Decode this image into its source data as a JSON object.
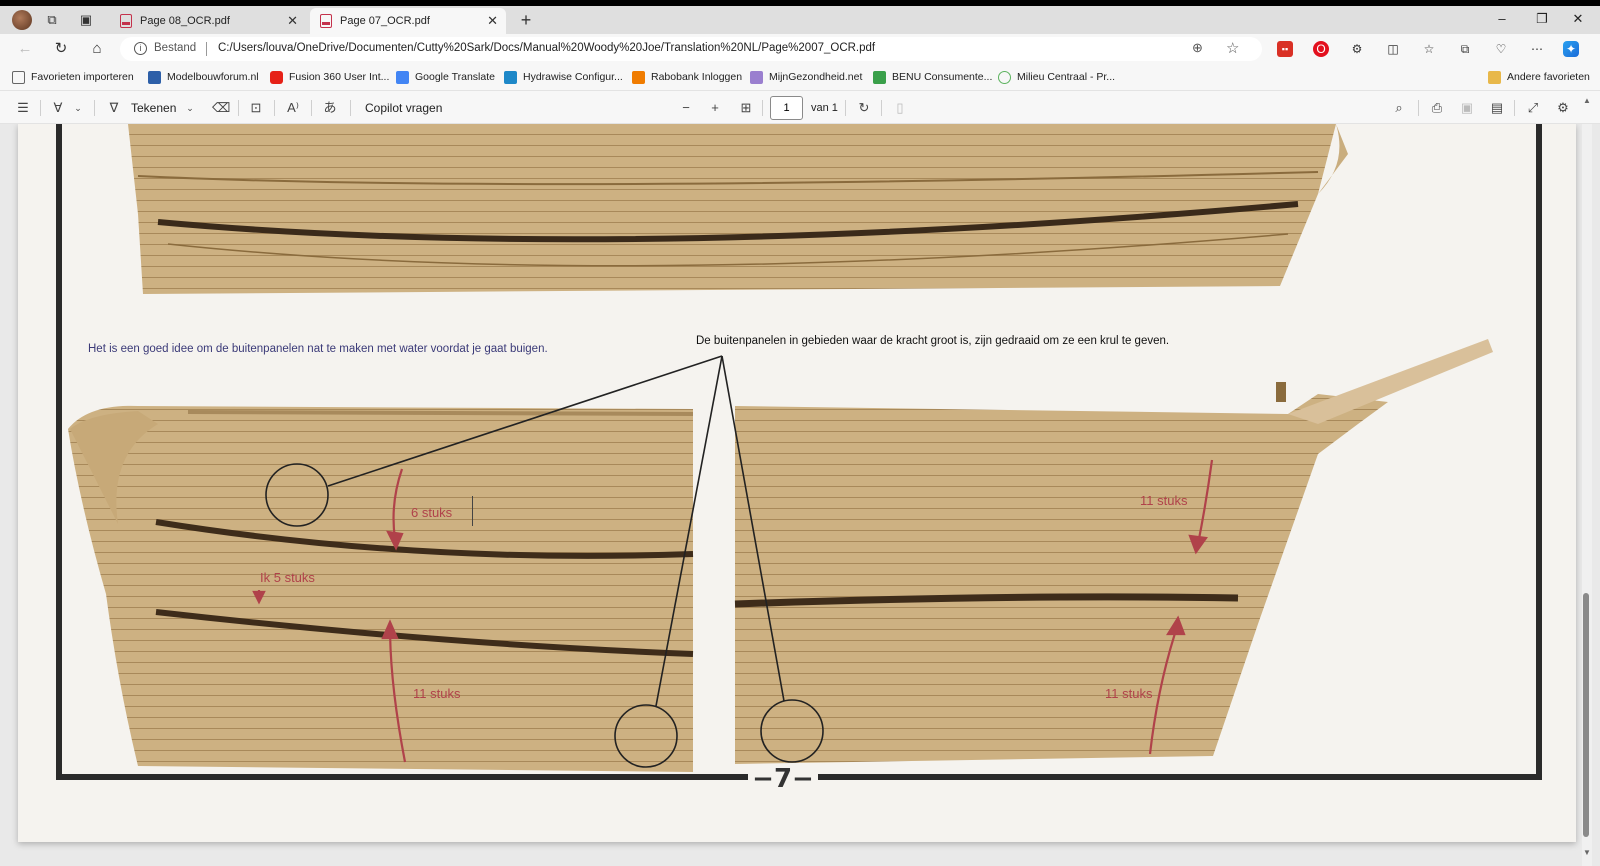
{
  "browser": {
    "tabs": [
      {
        "title": "Page 08_OCR.pdf",
        "active": false
      },
      {
        "title": "Page 07_OCR.pdf",
        "active": true
      }
    ],
    "new_tab": "+",
    "window_controls": {
      "minimize": "–",
      "restore": "❐",
      "close": "✕"
    }
  },
  "address": {
    "site_label": "Bestand",
    "url": "C:/Users/louva/OneDrive/Documenten/Cutty%20Sark/Docs/Manual%20Woody%20Joe/Translation%20NL/Page%2007_OCR.pdf"
  },
  "favorites": [
    {
      "label": "Favorieten importeren",
      "icon": "import-icon",
      "color": "#666666"
    },
    {
      "label": "Modelbouwforum.nl",
      "icon": "ship-icon",
      "color": "#2d5fa8"
    },
    {
      "label": "Fusion 360 User Int...",
      "icon": "youtube-icon",
      "color": "#e62117"
    },
    {
      "label": "Google Translate",
      "icon": "translate-icon",
      "color": "#4285f4"
    },
    {
      "label": "Hydrawise Configur...",
      "icon": "hydrawise-icon",
      "color": "#1e88c8"
    },
    {
      "label": "Rabobank Inloggen",
      "icon": "rabobank-icon",
      "color": "#f07c00"
    },
    {
      "label": "MijnGezondheid.net",
      "icon": "health-icon",
      "color": "#9a7fcf"
    },
    {
      "label": "BENU Consumente...",
      "icon": "benu-icon",
      "color": "#3aa04a"
    },
    {
      "label": "Milieu Centraal - Pr...",
      "icon": "milieu-icon",
      "color": "#5db35f"
    },
    {
      "label": "Andere favorieten",
      "icon": "folder-icon",
      "color": "#e8b84a"
    }
  ],
  "pdf_toolbar": {
    "draw_label": "Tekenen",
    "copilot_label": "Copilot vragen",
    "page_current": "1",
    "page_total_label": "van 1"
  },
  "document": {
    "caption_left": "Het is een goed idee om de buitenpanelen nat te maken met water voordat je gaat buigen.",
    "caption_right": "De buitenpanelen in gebieden waar de kracht groot is, zijn gedraaid om ze een krul te geven.",
    "labels": {
      "left_upper": "6 stuks",
      "left_mid": "Ik 5 stuks",
      "left_lower": "11 stuks",
      "right_upper": "11 stuks",
      "right_lower": "11 stuks"
    },
    "page_number": "−7−"
  },
  "colors": {
    "annotation_red": "#b0424a",
    "wood": "#cdb182",
    "wood_dark": "#9c7c4d",
    "frame": "#2a2a2a"
  }
}
